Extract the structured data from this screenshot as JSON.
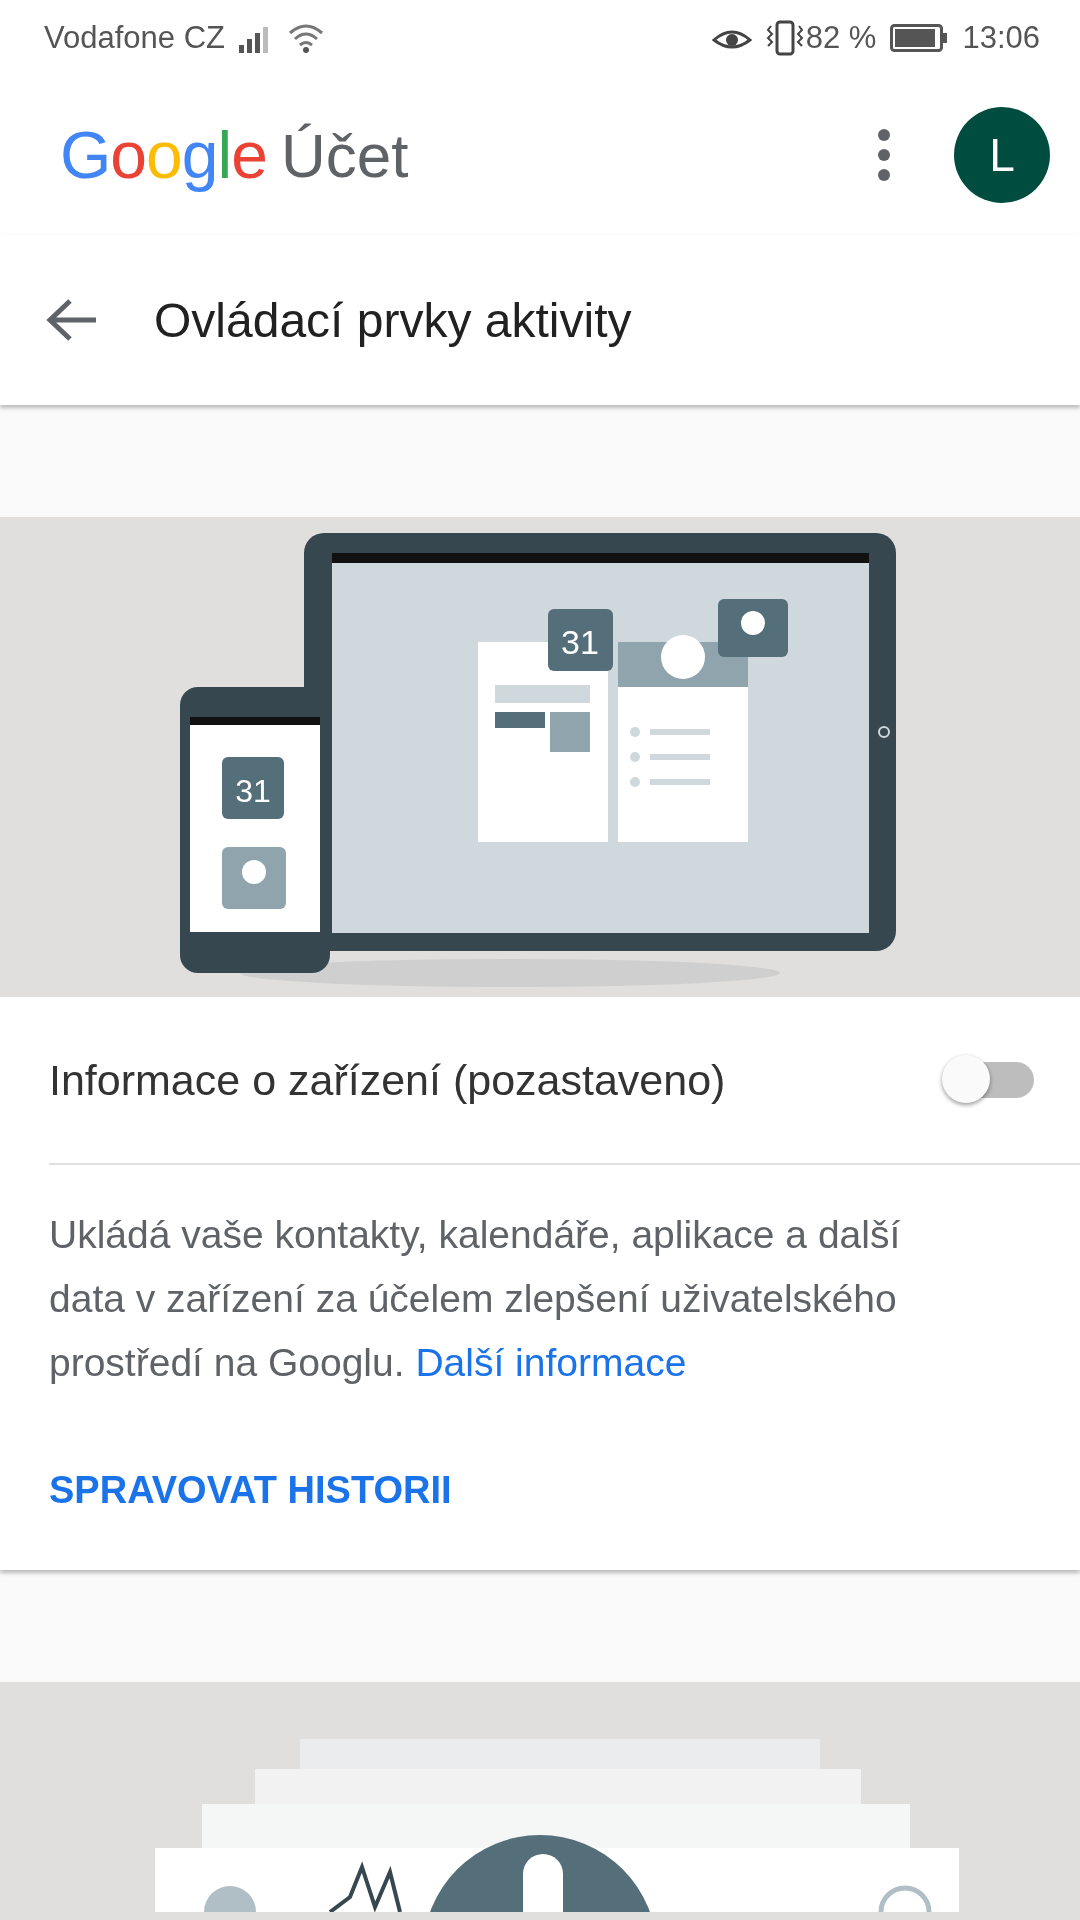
{
  "status_bar": {
    "carrier": "Vodafone CZ",
    "battery": "82 %",
    "time": "13:06"
  },
  "header": {
    "logo": "Google",
    "product": "Účet",
    "avatar": "L"
  },
  "toolbar": {
    "title": "Ovládací prvky aktivity"
  },
  "cards": [
    {
      "illustration": {
        "kind": "devices",
        "calendar_labels": [
          "31",
          "31"
        ]
      },
      "title": "Informace o zařízení (pozastaveno)",
      "on": false,
      "description": "Ukládá vaše kontakty, kalendáře, aplikace a další data v zařízení za účelem zlepšení uživatelského prostředí na Googlu.",
      "link": "Další informace",
      "action": "SPRAVOVAT HISTORII"
    },
    {
      "illustration": {
        "kind": "voice"
      }
    }
  ]
}
